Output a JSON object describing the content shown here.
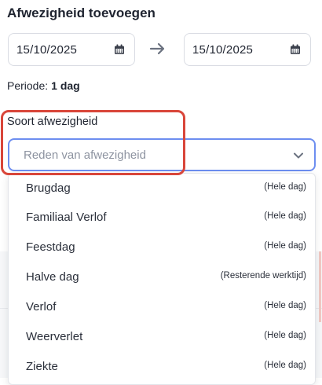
{
  "header": {
    "title": "Afwezigheid toevoegen"
  },
  "dates": {
    "start": "15/10/2025",
    "end": "15/10/2025"
  },
  "periode": {
    "label": "Periode:",
    "value": "1 dag"
  },
  "soort": {
    "label": "Soort afwezigheid",
    "placeholder": "Reden van afwezigheid",
    "options": [
      {
        "label": "Brugdag",
        "tag": "(Hele dag)"
      },
      {
        "label": "Familiaal Verlof",
        "tag": "(Hele dag)"
      },
      {
        "label": "Feestdag",
        "tag": "(Hele dag)"
      },
      {
        "label": "Halve dag",
        "tag": "(Resterende werktijd)"
      },
      {
        "label": "Verlof",
        "tag": "(Hele dag)"
      },
      {
        "label": "Weerverlet",
        "tag": "(Hele dag)"
      },
      {
        "label": "Ziekte",
        "tag": "(Hele dag)"
      }
    ]
  },
  "icons": {
    "calendar": "calendar-icon",
    "arrow": "arrow-right-icon",
    "chevron": "chevron-down-icon"
  },
  "colors": {
    "focus_border": "#6d8ef0",
    "highlight": "#d9463a",
    "text": "#1f2430",
    "placeholder": "#8d93a0"
  }
}
